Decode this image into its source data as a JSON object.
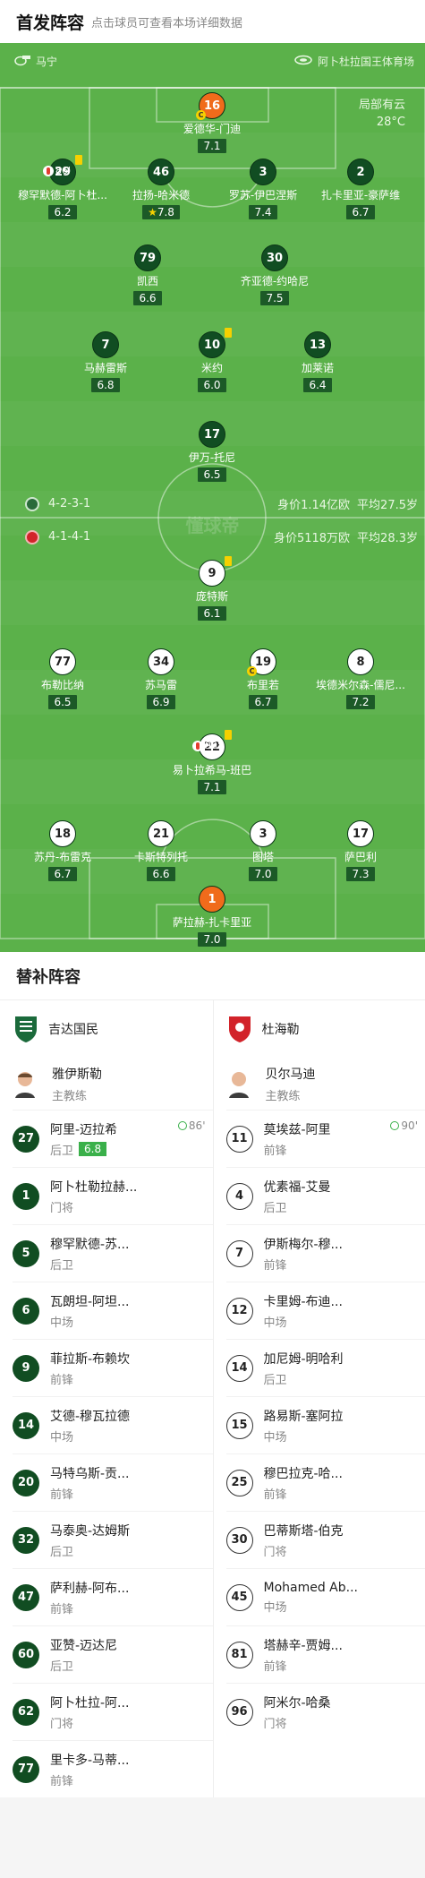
{
  "header": {
    "title": "首发阵容",
    "subtitle": "点击球员可查看本场详细数据"
  },
  "match": {
    "coach_label": "马宁",
    "venue": "阿卜杜拉国王体育场",
    "weather_desc": "局部有云",
    "temperature": "28°C",
    "brand": "懂球帝",
    "home_team": {
      "formation": "4-2-3-1",
      "value": "身价1.14亿欧",
      "avg_age": "平均27.5岁",
      "color": "#1b5c30"
    },
    "away_team": {
      "formation": "4-1-4-1",
      "value": "身价5118万欧",
      "avg_age": "平均28.3岁",
      "color": "#d2232a"
    }
  },
  "home_players": [
    {
      "num": "16",
      "name": "爱德华-门迪",
      "rating": "7.1",
      "gk": true,
      "captain": true
    },
    {
      "num": "29",
      "name": "穆罕默德-阿卜杜...",
      "rating": "6.2",
      "yellow": true,
      "sub_min": "86'"
    },
    {
      "num": "46",
      "name": "拉扬-哈米德",
      "rating": "7.8",
      "star": true
    },
    {
      "num": "3",
      "name": "罗苏-伊巴涅斯",
      "rating": "7.4"
    },
    {
      "num": "2",
      "name": "扎卡里亚-豪萨维",
      "rating": "6.7"
    },
    {
      "num": "79",
      "name": "凯西",
      "rating": "6.6"
    },
    {
      "num": "30",
      "name": "齐亚德-约哈尼",
      "rating": "7.5"
    },
    {
      "num": "7",
      "name": "马赫雷斯",
      "rating": "6.8"
    },
    {
      "num": "10",
      "name": "米约",
      "rating": "6.0",
      "yellow": true
    },
    {
      "num": "13",
      "name": "加莱诺",
      "rating": "6.4"
    },
    {
      "num": "17",
      "name": "伊万-托尼",
      "rating": "6.5"
    }
  ],
  "away_players": [
    {
      "num": "9",
      "name": "庞特斯",
      "rating": "6.1",
      "yellow": true
    },
    {
      "num": "77",
      "name": "布勒比纳",
      "rating": "6.5"
    },
    {
      "num": "34",
      "name": "苏马雷",
      "rating": "6.9"
    },
    {
      "num": "19",
      "name": "布里若",
      "rating": "6.7",
      "captain": true
    },
    {
      "num": "8",
      "name": "埃德米尔森-儒尼...",
      "rating": "7.2"
    },
    {
      "num": "22",
      "name": "易卜拉希马-班巴",
      "rating": "7.1",
      "yellow": true,
      "sub_min": "90'"
    },
    {
      "num": "18",
      "name": "苏丹-布雷克",
      "rating": "6.7"
    },
    {
      "num": "21",
      "name": "卡斯特列托",
      "rating": "6.6"
    },
    {
      "num": "3",
      "name": "图塔",
      "rating": "7.0"
    },
    {
      "num": "17",
      "name": "萨巴利",
      "rating": "7.3"
    },
    {
      "num": "1",
      "name": "萨拉赫-扎卡里亚",
      "rating": "7.0",
      "gk": true
    }
  ],
  "subs": {
    "title": "替补阵容",
    "home": {
      "team": "吉达国民",
      "coach": {
        "name": "雅伊斯勒",
        "role": "主教练"
      },
      "players": [
        {
          "num": "27",
          "name": "阿里-迈拉希",
          "pos": "后卫",
          "rating": "6.8",
          "min": "86'"
        },
        {
          "num": "1",
          "name": "阿卜杜勒拉赫...",
          "pos": "门将"
        },
        {
          "num": "5",
          "name": "穆罕默德-苏...",
          "pos": "后卫"
        },
        {
          "num": "6",
          "name": "瓦朗坦-阿坦...",
          "pos": "中场"
        },
        {
          "num": "9",
          "name": "菲拉斯-布赖坎",
          "pos": "前锋"
        },
        {
          "num": "14",
          "name": "艾德-穆瓦拉德",
          "pos": "中场"
        },
        {
          "num": "20",
          "name": "马特乌斯-贡...",
          "pos": "前锋"
        },
        {
          "num": "32",
          "name": "马泰奥-达姆斯",
          "pos": "后卫"
        },
        {
          "num": "47",
          "name": "萨利赫-阿布...",
          "pos": "前锋"
        },
        {
          "num": "60",
          "name": "亚赞-迈达尼",
          "pos": "后卫"
        },
        {
          "num": "62",
          "name": "阿卜杜拉-阿...",
          "pos": "门将"
        },
        {
          "num": "77",
          "name": "里卡多-马蒂...",
          "pos": "前锋"
        }
      ]
    },
    "away": {
      "team": "杜海勒",
      "coach": {
        "name": "贝尔马迪",
        "role": "主教练"
      },
      "players": [
        {
          "num": "11",
          "name": "莫埃兹-阿里",
          "pos": "前锋",
          "min": "90'"
        },
        {
          "num": "4",
          "name": "优素福-艾曼",
          "pos": "后卫"
        },
        {
          "num": "7",
          "name": "伊斯梅尔-穆...",
          "pos": "前锋"
        },
        {
          "num": "12",
          "name": "卡里姆-布迪...",
          "pos": "中场"
        },
        {
          "num": "14",
          "name": "加尼姆-明哈利",
          "pos": "后卫"
        },
        {
          "num": "15",
          "name": "路易斯-塞阿拉",
          "pos": "中场"
        },
        {
          "num": "25",
          "name": "穆巴拉克-哈...",
          "pos": "前锋"
        },
        {
          "num": "30",
          "name": "巴蒂斯塔-伯克",
          "pos": "门将"
        },
        {
          "num": "45",
          "name": "Mohamed Ab...",
          "pos": "中场"
        },
        {
          "num": "81",
          "name": "塔赫辛-贾姆...",
          "pos": "前锋"
        },
        {
          "num": "96",
          "name": "阿米尔-哈桑",
          "pos": "门将"
        }
      ]
    }
  }
}
